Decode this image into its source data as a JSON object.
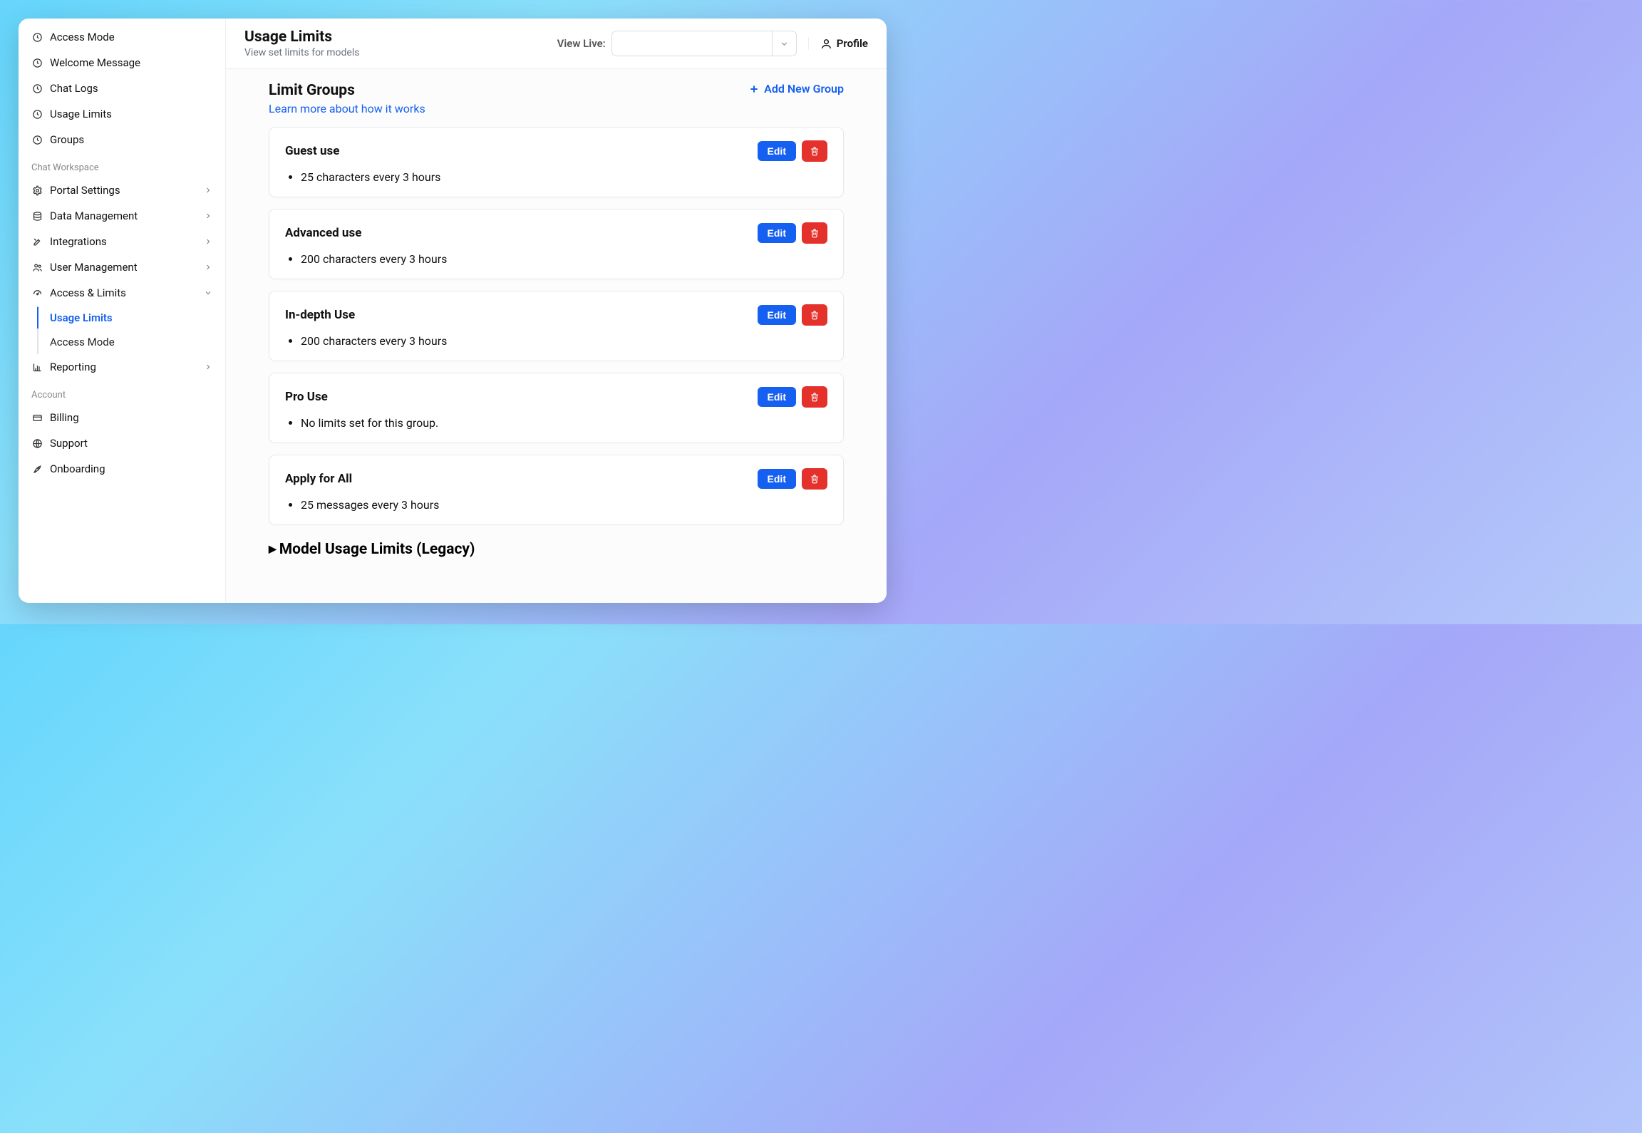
{
  "sidebar": {
    "top_items": [
      {
        "icon": "clock",
        "label": "Access Mode"
      },
      {
        "icon": "clock",
        "label": "Welcome Message"
      },
      {
        "icon": "clock",
        "label": "Chat Logs"
      },
      {
        "icon": "clock",
        "label": "Usage Limits"
      },
      {
        "icon": "clock",
        "label": "Groups"
      }
    ],
    "section_chat_workspace": "Chat Workspace",
    "workspace_items": [
      {
        "icon": "gear",
        "label": "Portal Settings",
        "expandable": true
      },
      {
        "icon": "stack",
        "label": "Data Management",
        "expandable": true
      },
      {
        "icon": "tools",
        "label": "Integrations",
        "expandable": true
      },
      {
        "icon": "users",
        "label": "User Management",
        "expandable": true
      },
      {
        "icon": "gauge",
        "label": "Access & Limits",
        "expandable": true,
        "expanded": true
      },
      {
        "icon": "chart",
        "label": "Reporting",
        "expandable": true
      }
    ],
    "access_limits_sub": [
      {
        "label": "Usage Limits",
        "active": true
      },
      {
        "label": "Access Mode",
        "active": false
      }
    ],
    "section_account": "Account",
    "account_items": [
      {
        "icon": "card",
        "label": "Billing"
      },
      {
        "icon": "globe",
        "label": "Support"
      },
      {
        "icon": "rocket",
        "label": "Onboarding"
      }
    ]
  },
  "header": {
    "title": "Usage Limits",
    "subtitle": "View set limits for models",
    "view_live_label": "View Live:",
    "view_live_value": "",
    "profile_label": "Profile"
  },
  "limit_groups": {
    "title": "Limit Groups",
    "learn_more": "Learn more about how it works",
    "add_new": "Add New Group",
    "edit_label": "Edit",
    "cards": [
      {
        "title": "Guest use",
        "lines": [
          "25 characters every 3 hours"
        ]
      },
      {
        "title": "Advanced use",
        "lines": [
          "200 characters every 3 hours"
        ]
      },
      {
        "title": "In-depth Use",
        "lines": [
          "200 characters every 3 hours"
        ]
      },
      {
        "title": "Pro Use",
        "lines": [
          "No limits set for this group."
        ]
      },
      {
        "title": "Apply for All",
        "lines": [
          "25 messages every 3 hours"
        ]
      }
    ]
  },
  "legacy_section_title": "Model Usage Limits (Legacy)"
}
